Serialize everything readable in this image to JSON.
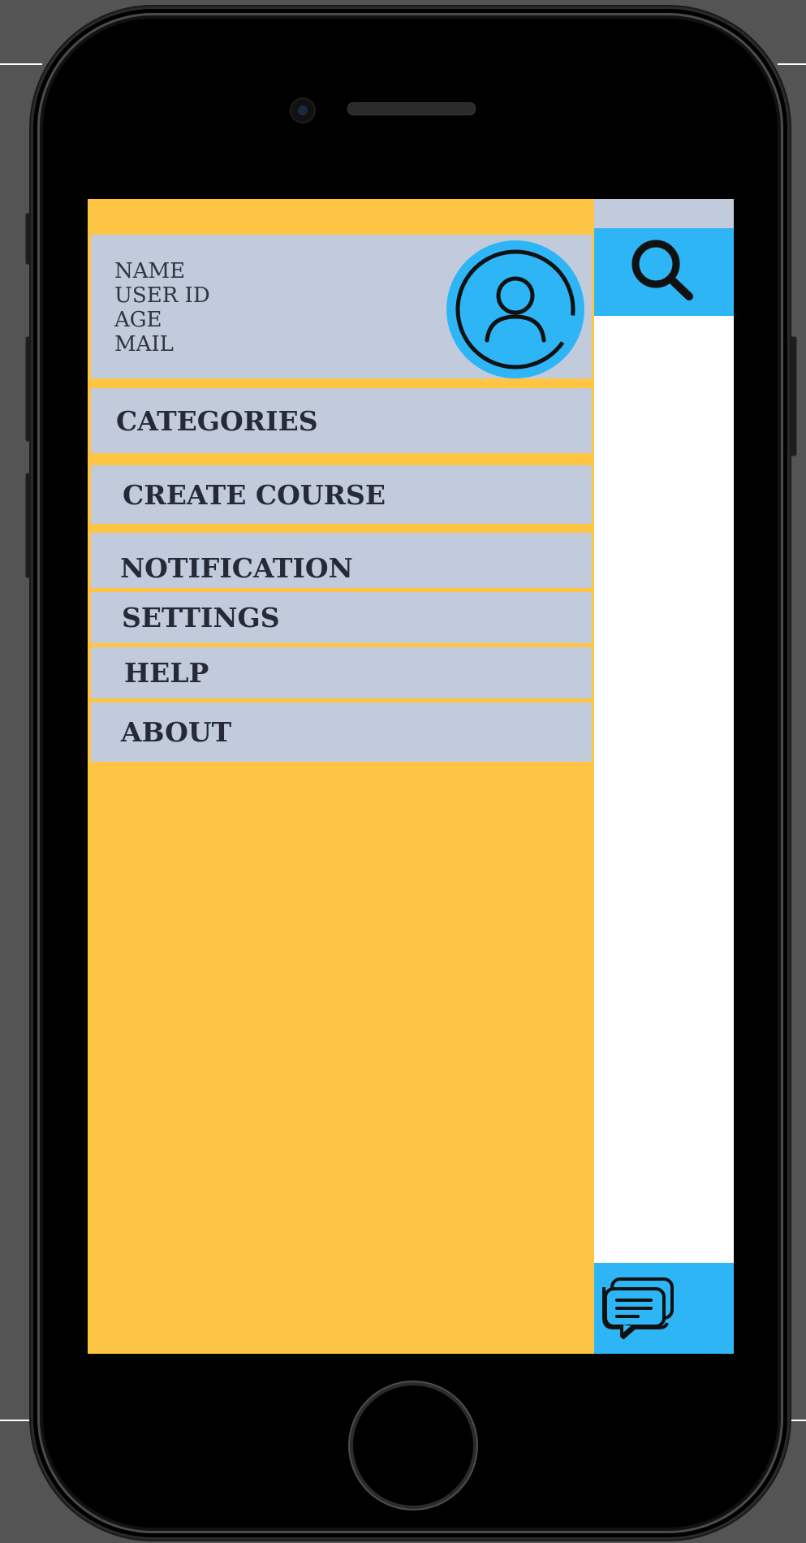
{
  "app": {
    "colors": {
      "background": "#545454",
      "drawer": "#fdc543",
      "card": "#c2cbdc",
      "accent": "#2eb5f5",
      "text": "#252a36"
    }
  },
  "profile": {
    "lines": [
      "NAME",
      "USER ID",
      "AGE",
      "MAIL"
    ],
    "avatar_icon": "user-circle-icon"
  },
  "menu": {
    "items": [
      {
        "label": "CATEGORIES"
      },
      {
        "label": "CREATE COURSE"
      },
      {
        "label": "NOTIFICATION"
      },
      {
        "label": "SETTINGS"
      },
      {
        "label": "HELP"
      },
      {
        "label": "ABOUT"
      }
    ]
  },
  "toolbar": {
    "search_icon": "search-icon",
    "chat_icon": "chat-icon"
  }
}
